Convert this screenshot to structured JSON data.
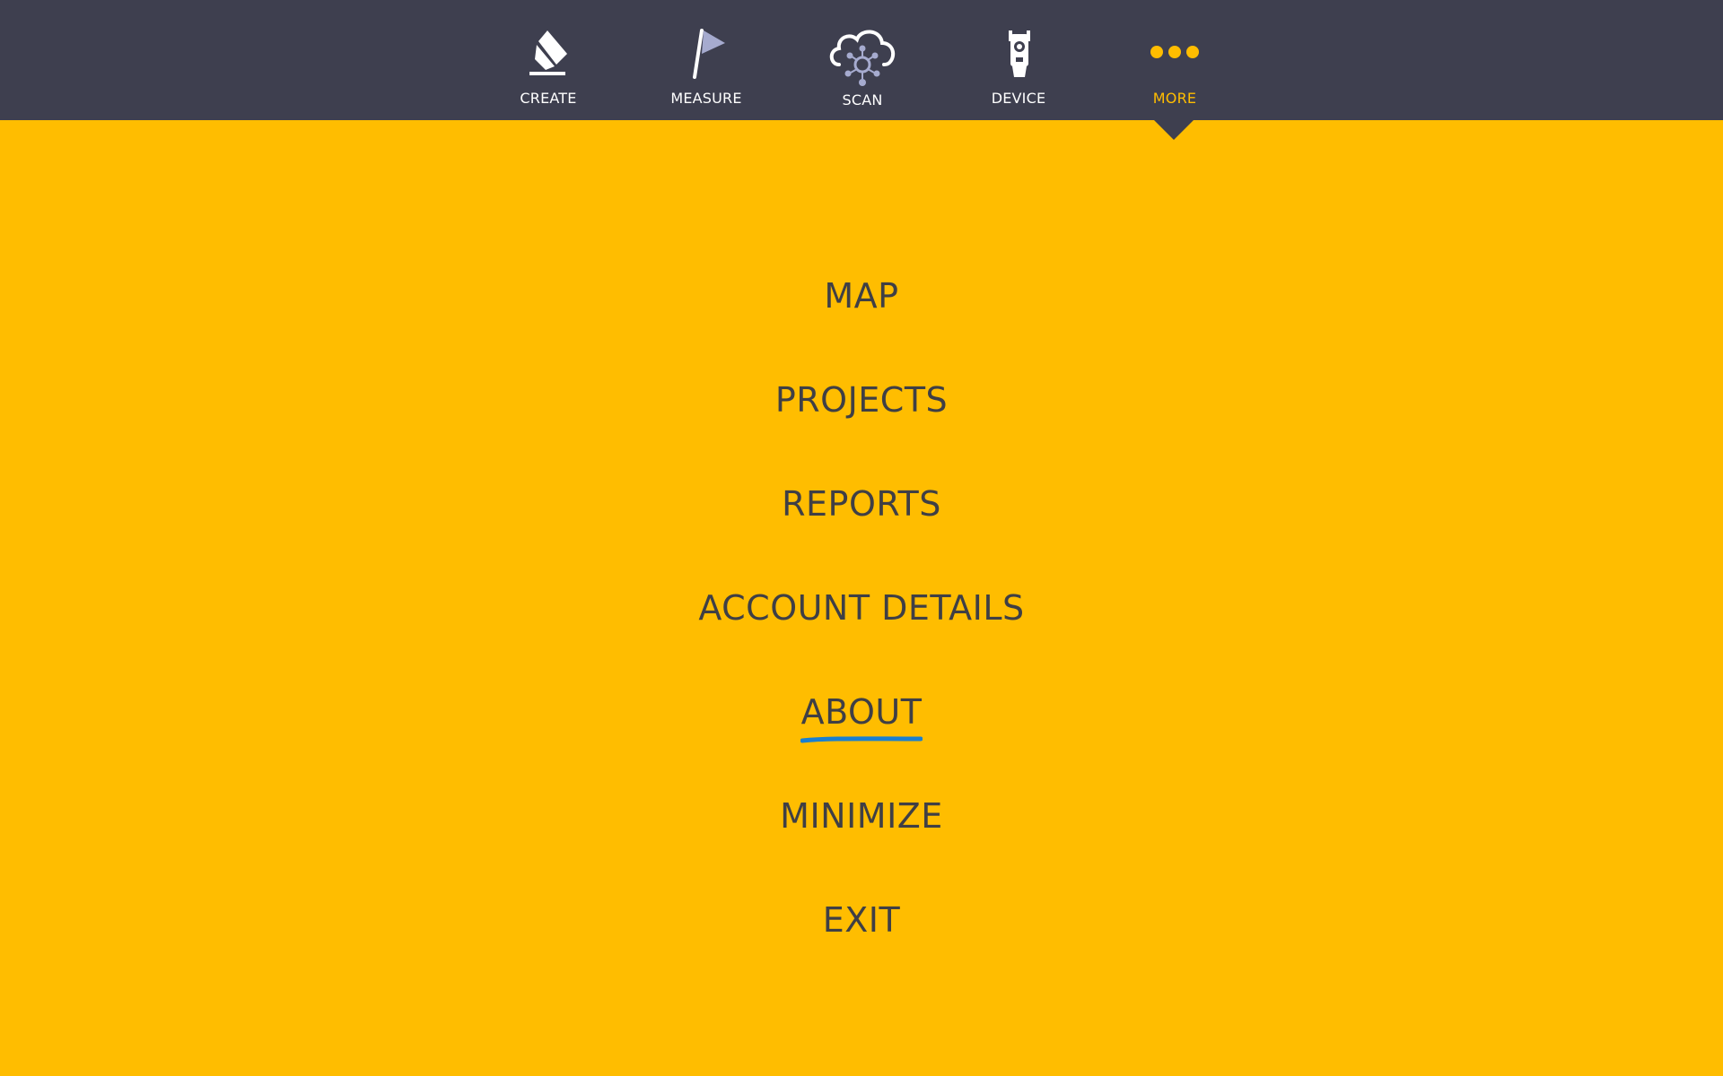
{
  "nav": {
    "items": [
      {
        "label": "CREATE",
        "icon": "pencil-icon",
        "active": false
      },
      {
        "label": "MEASURE",
        "icon": "flag-icon",
        "active": false
      },
      {
        "label": "SCAN",
        "icon": "cloud-scan-icon",
        "active": false
      },
      {
        "label": "DEVICE",
        "icon": "device-icon",
        "active": false
      },
      {
        "label": "MORE",
        "icon": "more-dots-icon",
        "active": true
      }
    ]
  },
  "menu": {
    "items": [
      {
        "label": "MAP"
      },
      {
        "label": "PROJECTS"
      },
      {
        "label": "REPORTS"
      },
      {
        "label": "ACCOUNT DETAILS"
      },
      {
        "label": "ABOUT",
        "underlined": true
      },
      {
        "label": "MINIMIZE"
      },
      {
        "label": "EXIT"
      }
    ]
  },
  "colors": {
    "background": "#FFBD00",
    "topbar": "#3E3F4F",
    "active_label": "#FFBD00",
    "menu_text": "#3F3F45",
    "underline_annotation": "#1A7FD0"
  }
}
